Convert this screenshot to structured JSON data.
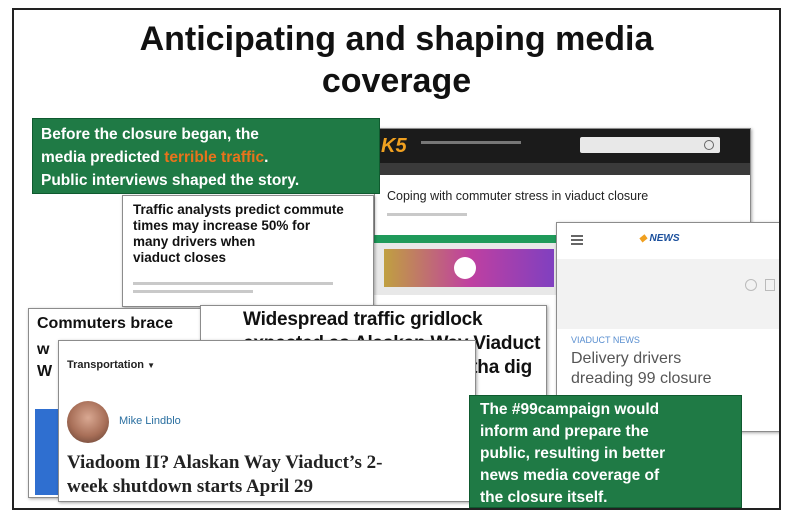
{
  "slide": {
    "title_line1": "Anticipating and shaping media",
    "title_line2": "coverage"
  },
  "callout_top": {
    "line1": "Before the closure began, the",
    "line2_prefix": "media predicted ",
    "line2_highlight": "terrible traffic",
    "line2_suffix": ".",
    "line3": "Public interviews shaped the story.",
    "highlight_color": "#e8731c",
    "bg_color": "#1f7a45"
  },
  "callout_bottom": {
    "lines": [
      "The #99campaign would",
      "inform and prepare the",
      "public, resulting in better",
      "news media coverage of",
      "the closure itself."
    ],
    "bg_color": "#1f7a45"
  },
  "king5_card": {
    "logo": "K5",
    "headline": "Coping with commuter stress in viaduct closure"
  },
  "analysts_card": {
    "headline_lines": [
      "Traffic analysts predict commute",
      "times may increase 50% for",
      "many drivers when",
      "viaduct closes"
    ]
  },
  "komo_card": {
    "logo": "NEWS",
    "section": "VIADUCT NEWS",
    "headline_lines": [
      "Delivery drivers",
      "dreading 99 closure"
    ]
  },
  "commuters_card": {
    "headline": "Commuters brace"
  },
  "gridlock_card": {
    "headline_lines": [
      "Widespread traffic gridlock",
      "expected as Alaskan Way Viaduct",
      "closes next Friday for Bertha dig"
    ]
  },
  "transportation_card": {
    "section": "Transportation",
    "author": "Mike Lindblo",
    "headline_lines": [
      "Viadoom II? Alaskan Way Viaduct’s 2-",
      "week shutdown starts April 29"
    ]
  }
}
